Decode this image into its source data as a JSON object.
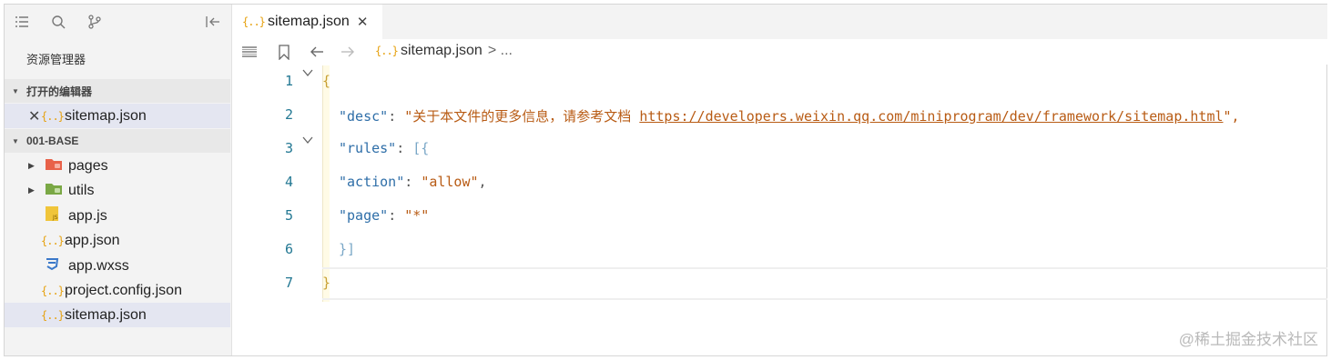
{
  "sidebar": {
    "toolbar": [
      {
        "icon": "list-icon"
      },
      {
        "icon": "search-icon"
      },
      {
        "icon": "source-control-icon"
      },
      {
        "icon": "collapse-panel-icon"
      }
    ],
    "title": "资源管理器",
    "open_editors": {
      "label": "打开的编辑器",
      "files": [
        {
          "name": "sitemap.json",
          "icon": "json-icon",
          "close_glyph": "✕"
        }
      ]
    },
    "project": {
      "label": "001-BASE",
      "items": [
        {
          "name": "pages",
          "type": "folder",
          "icon": "pages-folder-icon",
          "color": "#e8624a"
        },
        {
          "name": "utils",
          "type": "folder",
          "icon": "utils-folder-icon",
          "color": "#7aa845"
        },
        {
          "name": "app.js",
          "type": "js",
          "icon": "js-file-icon",
          "color": "#f0c53a"
        },
        {
          "name": "app.json",
          "type": "json",
          "icon": "json-icon"
        },
        {
          "name": "app.wxss",
          "type": "css",
          "icon": "wxss-file-icon",
          "color": "#3a78c9"
        },
        {
          "name": "project.config.json",
          "type": "json",
          "icon": "json-icon"
        },
        {
          "name": "sitemap.json",
          "type": "json",
          "icon": "json-icon"
        }
      ]
    }
  },
  "tab": {
    "title": "sitemap.json",
    "close_glyph": "✕"
  },
  "editor_toolbar": {
    "breadcrumb_file": "sitemap.json",
    "breadcrumb_more": "> ..."
  },
  "json_glyph": "{..}",
  "code": {
    "line_numbers": [
      "1",
      "2",
      "3",
      "4",
      "5",
      "6",
      "7"
    ],
    "l1_open": "{",
    "l2_key": "\"desc\"",
    "l2_colon": ": ",
    "l2_str": "\"关于本文件的更多信息，请参考文档 ",
    "l2_url": "https://developers.weixin.qq.com/miniprogram/dev/framework/sitemap.html",
    "l2_end": "\",",
    "l3_key": "\"rules\"",
    "l3_colon": ": ",
    "l3_open": "[{",
    "l4_key": "\"action\"",
    "l4_colon": ": ",
    "l4_val": "\"allow\"",
    "l4_comma": ",",
    "l5_key": "\"page\"",
    "l5_colon": ": ",
    "l5_val": "\"*\"",
    "l6_close": "}]",
    "l7_close": "}"
  },
  "watermark": "@稀土掘金技术社区"
}
